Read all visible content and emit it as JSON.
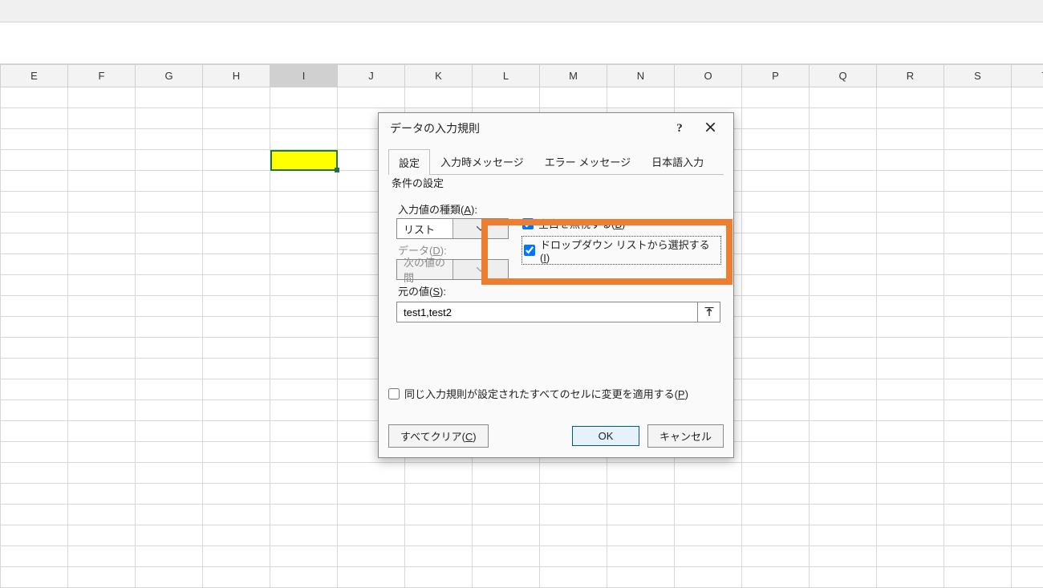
{
  "columns": [
    "E",
    "F",
    "G",
    "H",
    "I",
    "J",
    "K",
    "L",
    "M",
    "N",
    "O",
    "P",
    "Q",
    "R",
    "S",
    "T"
  ],
  "active_column_index": 4,
  "dialog": {
    "title": "データの入力規則",
    "tabs": [
      {
        "label": "設定",
        "active": true
      },
      {
        "label": "入力時メッセージ"
      },
      {
        "label": "エラー メッセージ"
      },
      {
        "label": "日本語入力"
      }
    ],
    "fieldset_legend": "条件の設定",
    "allow_label_pre": "入力値の種類(",
    "allow_label_key": "A",
    "allow_label_post": "):",
    "allow_value": "リスト",
    "data_label_pre": "データ(",
    "data_label_key": "D",
    "data_label_post": "):",
    "data_value": "次の値の間",
    "chk_blank_pre": "空白を無視する(",
    "chk_blank_key": "B",
    "chk_blank_post": ")",
    "chk_dd_pre": "ドロップダウン リストから選択する(",
    "chk_dd_key": "I",
    "chk_dd_post": ")",
    "source_label_pre": "元の値(",
    "source_label_key": "S",
    "source_label_post": "):",
    "source_value": "test1,test2",
    "apply_all_pre": "同じ入力規則が設定されたすべてのセルに変更を適用する(",
    "apply_all_key": "P",
    "apply_all_post": ")",
    "clear_pre": "すべてクリア(",
    "clear_key": "C",
    "clear_post": ")",
    "ok_label": "OK",
    "cancel_label": "キャンセル"
  }
}
